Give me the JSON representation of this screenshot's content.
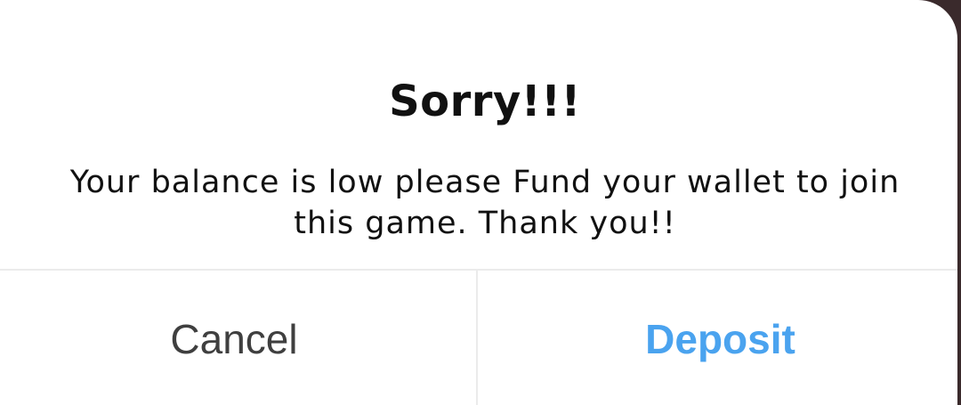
{
  "dialog": {
    "title": "Sorry!!!",
    "message": "Your balance is low please Fund your wallet to join this game. Thank you!!",
    "cancel_label": "Cancel",
    "deposit_label": "Deposit"
  },
  "colors": {
    "accent": "#4aa3ef",
    "backdrop": "#3a2a2c"
  }
}
